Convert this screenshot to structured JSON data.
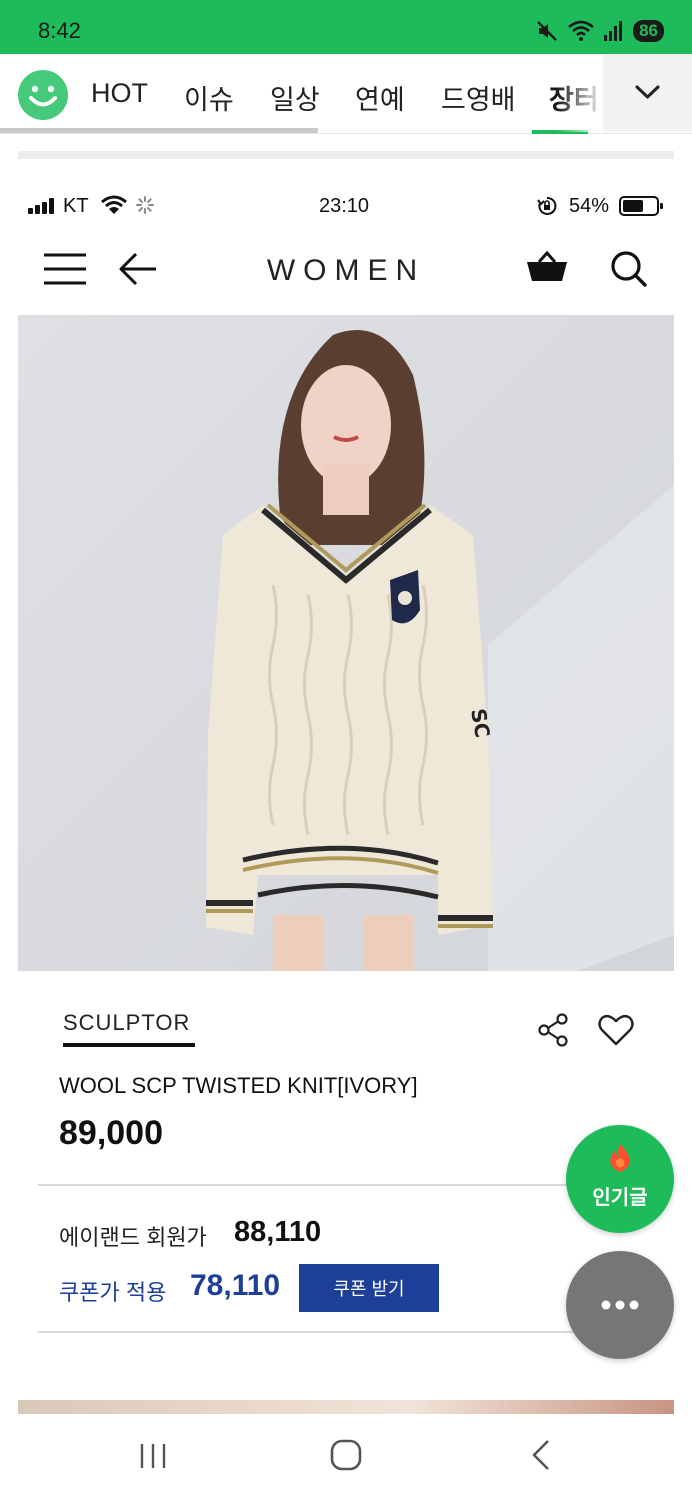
{
  "android_status": {
    "time": "8:42",
    "battery": "86",
    "icons": [
      "mute-icon",
      "wifi-icon",
      "signal-icon"
    ]
  },
  "tabs": {
    "items": [
      {
        "label": "HOT"
      },
      {
        "label": "이슈"
      },
      {
        "label": "일상"
      },
      {
        "label": "연예"
      },
      {
        "label": "드영배"
      },
      {
        "label": "장터"
      }
    ],
    "active_index": 5,
    "more_icon": "chevron-down-icon"
  },
  "ios_status": {
    "carrier": "KT",
    "time": "23:10",
    "battery": "54%"
  },
  "app_header": {
    "title": "WOMEN"
  },
  "product": {
    "brand": "SCULPTOR",
    "name": "WOOL SCP TWISTED KNIT[IVORY]",
    "price": "89,000",
    "member_label": "에이랜드 회원가",
    "member_price": "88,110",
    "coupon_label": "쿠폰가 적용",
    "coupon_price": "78,110",
    "coupon_button": "쿠폰 받기"
  },
  "floating": {
    "popular_label": "인기글"
  },
  "colors": {
    "brand_green": "#1dbb5a",
    "coupon_blue": "#1d3f97"
  }
}
